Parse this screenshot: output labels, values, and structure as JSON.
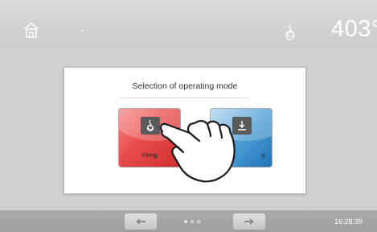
{
  "header": {
    "temperature": "403°",
    "home_icon": "home-icon",
    "flame_icon": "flame-icon"
  },
  "dialog": {
    "title": "Selection of operating mode",
    "modes": [
      {
        "label": "Firing",
        "icon": "flame-icon",
        "color": "#e84b4b"
      },
      {
        "label": "p",
        "icon": "download-icon",
        "color": "#4f9fd6"
      }
    ]
  },
  "footer": {
    "prev_icon": "arrow-left-icon",
    "next_icon": "arrow-right-icon",
    "page_count": 3,
    "active_page": 1,
    "clock": "16:28:39"
  }
}
